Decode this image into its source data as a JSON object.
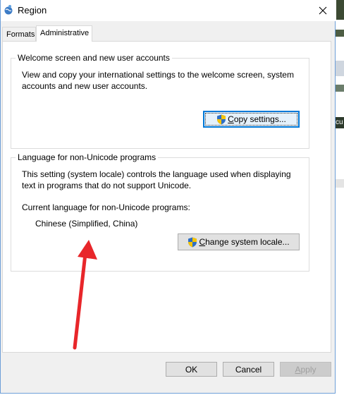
{
  "window": {
    "title": "Region",
    "close_glyph": "✕"
  },
  "tabs": [
    {
      "label": "Formats",
      "selected": false
    },
    {
      "label": "Administrative",
      "selected": true
    }
  ],
  "welcome_group": {
    "title": "Welcome screen and new user accounts",
    "description_line1": "View and copy your international settings to the welcome screen, system",
    "description_line2": "accounts and new user accounts.",
    "copy_button": {
      "accel": "C",
      "rest": "opy settings...",
      "icon": "uac-shield-icon"
    }
  },
  "language_group": {
    "title": "Language for non-Unicode programs",
    "description_line1": "This setting (system locale) controls the language used when displaying",
    "description_line2": "text in programs that do not support Unicode.",
    "current_label": "Current language for non-Unicode programs:",
    "current_value": "Chinese (Simplified, China)",
    "change_button": {
      "accel": "C",
      "rest": "hange system locale...",
      "icon": "uac-shield-icon"
    }
  },
  "annotation": {
    "arrow_color": "#e8262a"
  },
  "footer": {
    "ok_label": "OK",
    "cancel_label": "Cancel",
    "apply_accel": "A",
    "apply_rest": "pply"
  },
  "background": {
    "strip_text": "cu"
  }
}
